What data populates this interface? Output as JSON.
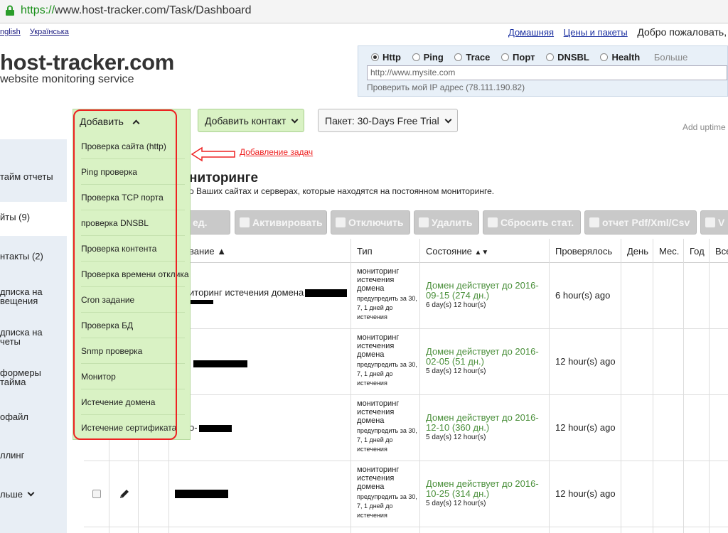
{
  "browser": {
    "url_scheme": "https://",
    "url_rest": "www.host-tracker.com/Task/Dashboard"
  },
  "languages": [
    "nglish",
    "Українська"
  ],
  "topnav": {
    "home": "Домашняя",
    "prices": "Цены и пакеты",
    "welcome": "Добро пожаловать,"
  },
  "brand": {
    "logo": "host-tracker.com",
    "tagline": "website monitoring service"
  },
  "check_panel": {
    "options": [
      "Http",
      "Ping",
      "Trace",
      "Порт",
      "DNSBL",
      "Health"
    ],
    "selected": "Http",
    "more": "Больше",
    "input_placeholder": "http://www.mysite.com",
    "my_ip": "Проверить мой IP адрес (78.111.190.82)"
  },
  "toolbar": {
    "add_contact": "Добавить контакт",
    "package": "Пакет: 30-Days Free Trial",
    "add_uptime": "Add uptime"
  },
  "sidebar": {
    "items": [
      "тайм отчеты",
      "йты (9)",
      "нтакты (2)",
      "дписка на",
      "вещения",
      "дписка на",
      "четы",
      "формеры",
      "тайма",
      "офайл",
      "ллинг",
      "льше"
    ]
  },
  "section": {
    "title": "ниторинге",
    "subtitle": "о Ваших сайтах и серверах, которые находятся на постоянном мониторинге."
  },
  "actions": [
    "ед.",
    "Активировать",
    "Отключить",
    "Удалить",
    "Сбросить стат.",
    "отчет Pdf/Xml/Csv",
    "V"
  ],
  "table": {
    "headers": [
      "вание",
      "Тип",
      "Состояние",
      "Проверялось",
      "День",
      "Мес.",
      "Год",
      "Все"
    ],
    "type_main": "мониторинг истечения домена",
    "type_small": "предупредить за 30, 7, 1 дней до истечения",
    "rows": [
      {
        "name": "иторинг истечения домена",
        "state": "Домен действует до 2016-09-15 (274 дн.)",
        "state_small": "6 day(s) 12 hour(s)",
        "checked": "6 hour(s) ago"
      },
      {
        "name": "",
        "state": "Домен действует до 2016-02-05 (51 дн.)",
        "state_small": "5 day(s) 12 hour(s)",
        "checked": "12 hour(s) ago"
      },
      {
        "name": "o-",
        "state": "Домен действует до 2016-12-10 (360 дн.)",
        "state_small": "5 day(s) 12 hour(s)",
        "checked": "12 hour(s) ago"
      },
      {
        "name": "",
        "state": "Домен действует до 2016-10-25 (314 дн.)",
        "state_small": "5 day(s) 12 hour(s)",
        "checked": "12 hour(s) ago"
      }
    ]
  },
  "dropdown": {
    "label": "Добавить",
    "items": [
      "Проверка сайта (http)",
      "Ping проверка",
      "Проверка TCP порта",
      "проверка DNSBL",
      "Проверка контента",
      "Проверка времени отклика",
      "Cron задание",
      "Проверка БД",
      "Snmp проверка",
      "Монитор",
      "Истечение домена",
      "Истечение сертификата"
    ]
  },
  "annotation": {
    "text": "Добавление задач"
  },
  "colors": {
    "green_bg": "#d9f2c4",
    "annotation_red": "#e22",
    "state_green": "#4a8f3a"
  }
}
